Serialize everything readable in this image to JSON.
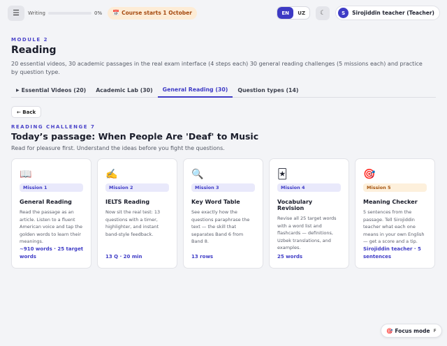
{
  "topbar": {
    "menu_icon": "☰",
    "progress_label": "Writing",
    "progress_value": 0,
    "progress_pct": "0%",
    "course_icon": "📅",
    "course_label": "Course starts 1 October",
    "lang_en": "EN",
    "lang_uz": "UZ",
    "theme_icon": "☾",
    "avatar_initial": "S",
    "user_name": "Sirojiddin teacher (Teacher)"
  },
  "header": {
    "module": "MODULE 2",
    "title": "Reading",
    "description": "20 essential videos, 30 academic passages in the real exam interface (4 steps each) 30 general reading challenges (5 missions each) and practice by question type."
  },
  "tabs": [
    {
      "icon": "▶",
      "label": "Essential Videos (20)"
    },
    {
      "icon": "",
      "label": "Academic Lab (30)"
    },
    {
      "icon": "",
      "label": "General Reading (30)"
    },
    {
      "icon": "",
      "label": "Question types (14)"
    }
  ],
  "back": {
    "label": "← Back"
  },
  "challenge": {
    "label": "READING CHALLENGE 7",
    "title": "Today’s passage: When People Are 'Deaf' to Music",
    "subtitle": "Read for pleasure first. Understand the ideas before you fight the questions."
  },
  "cards": [
    {
      "icon": "📖",
      "badge": "Mission 1",
      "title": "General Reading",
      "desc": "Read the passage as an article. Listen to a fluent American voice and tap the golden words to learn their meanings.",
      "meta": "~910 words · 25 target words"
    },
    {
      "icon": "✍️",
      "badge": "Mission 2",
      "title": "IELTS Reading",
      "desc": "Now sit the real test: 13 questions with a timer, highlighter, and instant band-style feedback.",
      "meta": "13 Q · 20 min"
    },
    {
      "icon": "🔍",
      "badge": "Mission 3",
      "title": "Key Word Table",
      "desc": "See exactly how the questions paraphrase the text — the skill that separates Band 6 from Band 8.",
      "meta": "13 rows"
    },
    {
      "icon": "🃏",
      "badge": "Mission 4",
      "title": "Vocabulary Revision",
      "desc": "Revise all 25 target words with a word list and flashcards — definitions, Uzbek translations, and examples.",
      "meta": "25 words"
    },
    {
      "icon": "🎯",
      "badge": "Mission 5",
      "title": "Meaning Checker",
      "desc": "5 sentences from the passage. Tell Sirojiddin teacher what each one means in your own English — get a score and a tip.",
      "meta": "Sirojiddin teacher · 5 sentences"
    }
  ],
  "focus": {
    "icon": "🎯",
    "label": "Focus mode",
    "key": "F"
  }
}
